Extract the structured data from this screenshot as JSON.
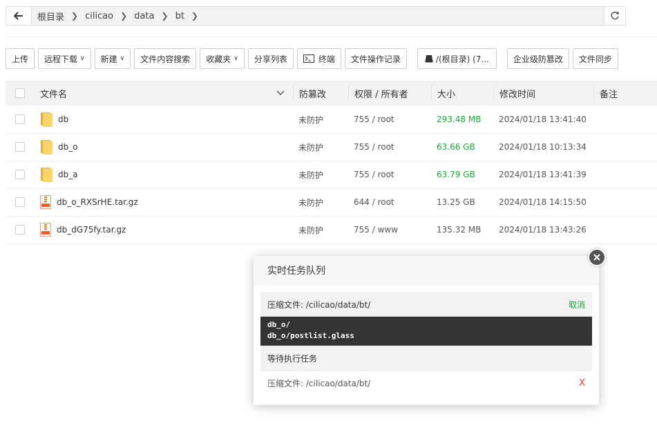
{
  "pathbar": {
    "crumbs": [
      "根目录",
      "cilicao",
      "data",
      "bt"
    ]
  },
  "toolbar": {
    "upload": "上传",
    "remote_download": "远程下载",
    "new": "新建",
    "content_search": "文件内容搜索",
    "favorites": "收藏夹",
    "share_list": "分享列表",
    "terminal": "终端",
    "operation_log": "文件操作记录",
    "disk": "/(根目录) (7...",
    "enterprise_protect": "企业级防篡改",
    "file_sync": "文件同步"
  },
  "table": {
    "headers": {
      "name": "文件名",
      "protect": "防篡改",
      "perm": "权限 / 所有者",
      "size": "大小",
      "mtime": "修改时间",
      "note": "备注"
    },
    "rows": [
      {
        "type": "folder",
        "name": "db",
        "protect": "未防护",
        "perm": "755 / root",
        "size": "293.48 MB",
        "mtime": "2024/01/18 13:41:40"
      },
      {
        "type": "folder",
        "name": "db_o",
        "protect": "未防护",
        "perm": "755 / root",
        "size": "63.66 GB",
        "mtime": "2024/01/18 10:13:34"
      },
      {
        "type": "folder",
        "name": "db_a",
        "protect": "未防护",
        "perm": "755 / root",
        "size": "63.79 GB",
        "mtime": "2024/01/18 13:41:39"
      },
      {
        "type": "archive",
        "name": "db_o_RXSrHE.tar.gz",
        "protect": "未防护",
        "perm": "644 / root",
        "size": "13.25 GB",
        "mtime": "2024/01/18 14:15:50"
      },
      {
        "type": "archive",
        "name": "db_dG75fy.tar.gz",
        "protect": "未防护",
        "perm": "755 / www",
        "size": "135.32 MB",
        "mtime": "2024/01/18 13:43:26"
      }
    ]
  },
  "dialog": {
    "title": "实时任务队列",
    "running_task": "压缩文件: /cilicao/data/bt/",
    "cancel": "取消",
    "log_lines": [
      "db_o/",
      "db_o/postlist.glass"
    ],
    "waiting_title": "等待执行任务",
    "waiting_task": "压缩文件: /cilicao/data/bt/",
    "remove": "X"
  },
  "colors": {
    "accent_green": "#20a53a",
    "danger_red": "#e03e2d"
  }
}
